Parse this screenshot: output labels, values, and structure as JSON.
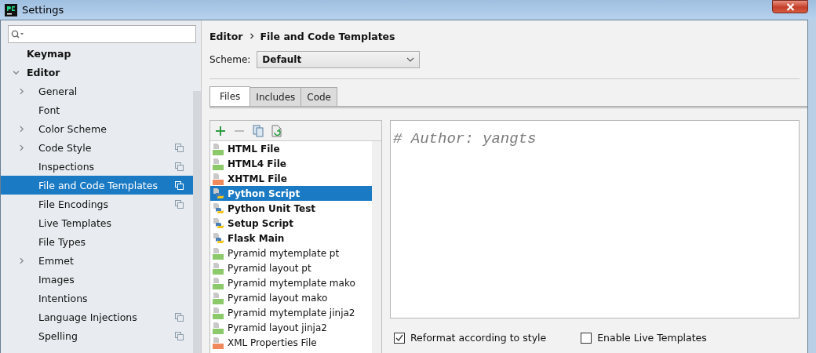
{
  "window": {
    "title": "Settings"
  },
  "sidebar": {
    "items": [
      {
        "label": "Keymap"
      },
      {
        "label": "Editor",
        "expanded": true,
        "children": [
          {
            "label": "General",
            "expanded": false,
            "project_scope": false,
            "selected": false
          },
          {
            "label": "Font",
            "project_scope": false,
            "selected": false
          },
          {
            "label": "Color Scheme",
            "expanded": false,
            "project_scope": false,
            "selected": false
          },
          {
            "label": "Code Style",
            "expanded": false,
            "project_scope": true,
            "selected": false
          },
          {
            "label": "Inspections",
            "project_scope": true,
            "selected": false
          },
          {
            "label": "File and Code Templates",
            "project_scope": true,
            "selected": true
          },
          {
            "label": "File Encodings",
            "project_scope": true,
            "selected": false
          },
          {
            "label": "Live Templates",
            "project_scope": false,
            "selected": false
          },
          {
            "label": "File Types",
            "project_scope": false,
            "selected": false
          },
          {
            "label": "Emmet",
            "expanded": false,
            "project_scope": false,
            "selected": false
          },
          {
            "label": "Images",
            "project_scope": false,
            "selected": false
          },
          {
            "label": "Intentions",
            "project_scope": false,
            "selected": false
          },
          {
            "label": "Language Injections",
            "project_scope": true,
            "selected": false
          },
          {
            "label": "Spelling",
            "project_scope": true,
            "selected": false
          }
        ]
      }
    ]
  },
  "breadcrumb": [
    "Editor",
    "File and Code Templates"
  ],
  "scheme": {
    "label": "Scheme:",
    "value": "Default"
  },
  "tabs": [
    {
      "label": "Files",
      "selected": true
    },
    {
      "label": "Includes",
      "selected": false
    },
    {
      "label": "Code",
      "selected": false
    }
  ],
  "templates": [
    {
      "name": "HTML File",
      "kind": "html",
      "bold": true,
      "selected": false
    },
    {
      "name": "HTML4 File",
      "kind": "html",
      "bold": true,
      "selected": false
    },
    {
      "name": "XHTML File",
      "kind": "xhtml",
      "bold": true,
      "selected": false
    },
    {
      "name": "Python Script",
      "kind": "python",
      "bold": true,
      "selected": true
    },
    {
      "name": "Python Unit Test",
      "kind": "python",
      "bold": true,
      "selected": false
    },
    {
      "name": "Setup Script",
      "kind": "python",
      "bold": true,
      "selected": false
    },
    {
      "name": "Flask Main",
      "kind": "python",
      "bold": true,
      "selected": false
    },
    {
      "name": "Pyramid mytemplate pt",
      "kind": "chameleon",
      "bold": false,
      "selected": false
    },
    {
      "name": "Pyramid layout pt",
      "kind": "chameleon",
      "bold": false,
      "selected": false
    },
    {
      "name": "Pyramid mytemplate mako",
      "kind": "mako",
      "bold": false,
      "selected": false
    },
    {
      "name": "Pyramid layout mako",
      "kind": "mako",
      "bold": false,
      "selected": false
    },
    {
      "name": "Pyramid mytemplate jinja2",
      "kind": "jinja2",
      "bold": false,
      "selected": false
    },
    {
      "name": "Pyramid layout jinja2",
      "kind": "jinja2",
      "bold": false,
      "selected": false
    },
    {
      "name": "XML Properties File",
      "kind": "xml",
      "bold": false,
      "selected": false
    }
  ],
  "editor": {
    "text": "# Author: yangts"
  },
  "options": [
    {
      "label": "Reformat according to style",
      "checked": true
    },
    {
      "label": "Enable Live Templates",
      "checked": false
    }
  ]
}
